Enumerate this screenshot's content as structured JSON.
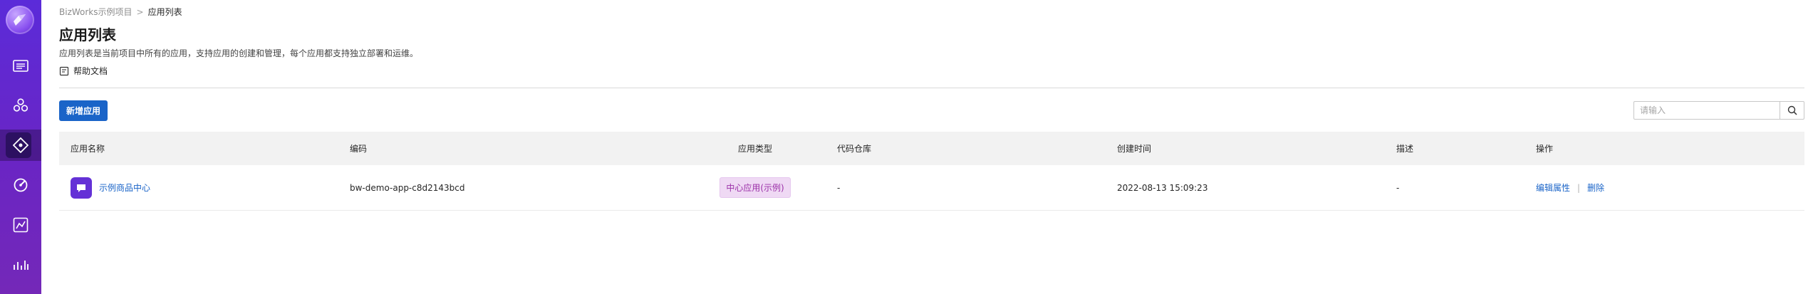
{
  "breadcrumb": {
    "parent": "BizWorks示例项目",
    "separator": ">",
    "current": "应用列表"
  },
  "page": {
    "title": "应用列表",
    "description": "应用列表是当前项目中所有的应用，支持应用的创建和管理，每个应用都支持独立部署和运维。",
    "help_label": "帮助文档"
  },
  "toolbar": {
    "add_label": "新增应用",
    "search_placeholder": "请输入"
  },
  "table": {
    "columns": [
      "应用名称",
      "编码",
      "应用类型",
      "代码仓库",
      "创建时间",
      "描述",
      "操作"
    ],
    "rows": [
      {
        "name": "示例商品中心",
        "code": "bw-demo-app-c8d2143bcd",
        "type": "中心应用(示例)",
        "repo": "-",
        "created": "2022-08-13 15:09:23",
        "description": "-",
        "actions": {
          "edit": "编辑属性",
          "sep": "|",
          "delete": "删除"
        }
      }
    ]
  },
  "sidebar": {
    "icons": [
      "app-logo-icon",
      "dashboard-icon",
      "cluster-icon",
      "api-gateway-icon",
      "monitor-icon",
      "diagram-icon",
      "analytics-icon"
    ],
    "active_index": 3
  },
  "colors": {
    "sidebar": "#5b2bd9",
    "primary": "#1a64c8",
    "badge_bg": "#efd9f4",
    "badge_text": "#9b30a8",
    "app_icon": "#6431d6"
  }
}
